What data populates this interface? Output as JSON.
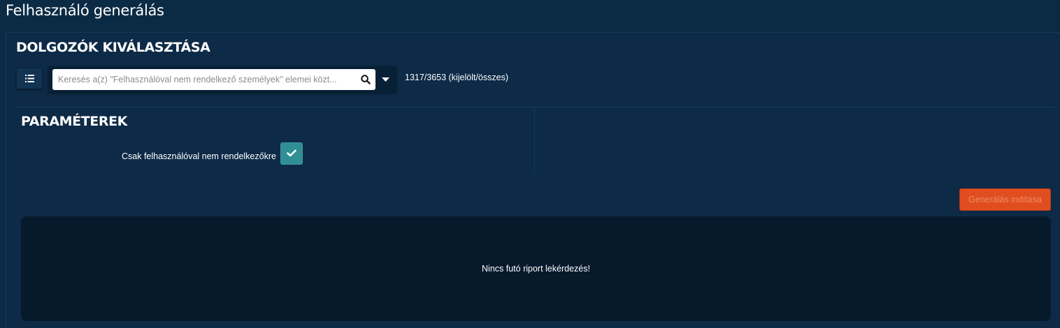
{
  "page": {
    "title": "Felhasználó generálás"
  },
  "employees": {
    "title": "DOLGOZÓK KIVÁLASZTÁSA",
    "search_placeholder": "Keresés a(z) \"Felhasználóval nem rendelkező személyek\" elemei közt...",
    "search_value": "",
    "count_text": "1317/3653 (kijelölt/összes)"
  },
  "parameters": {
    "title": "PARAMÉTEREK",
    "checkbox_label": "Csak felhasználóval nem rendelkezőkre",
    "checkbox_checked": true
  },
  "actions": {
    "start_label": "Generálás indítása"
  },
  "report": {
    "message": "Nincs futó riport lekérdezés!"
  },
  "colors": {
    "background": "#0b2b45",
    "panel": "#0d2a47",
    "report_box": "#061a2c",
    "checkbox": "#2f8f95",
    "start_button": "#e04e1f"
  },
  "icons": {
    "list": "list-icon",
    "search": "search-icon",
    "dropdown": "caret-down-icon",
    "check": "check-icon"
  }
}
